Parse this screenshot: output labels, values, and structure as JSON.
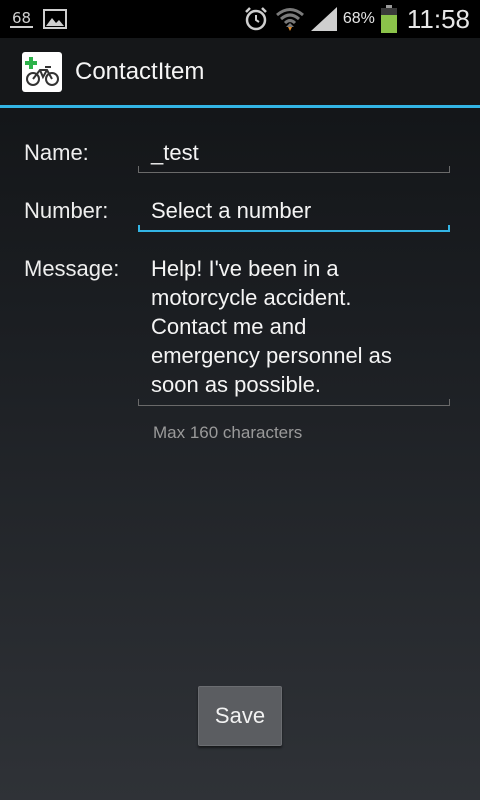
{
  "status_bar": {
    "notification_badge": "68",
    "battery_percent": "68%",
    "clock": "11:58",
    "icons": [
      "notification-68-icon",
      "image-icon",
      "alarm-icon",
      "wifi-icon",
      "signal-icon",
      "battery-icon"
    ],
    "battery_color": "#8bc34a"
  },
  "action_bar": {
    "title": "ContactItem",
    "accent_color": "#33b5e5"
  },
  "form": {
    "name_label": "Name:",
    "name_value": "_test",
    "number_label": "Number:",
    "number_value": "Select a number",
    "message_label": "Message:",
    "message_lines": [
      "Help! I've been in a",
      "motorcycle accident.",
      "Contact me and",
      "emergency personnel as",
      "soon as possible."
    ],
    "message_hint": "Max 160 characters"
  },
  "actions": {
    "save_label": "Save"
  }
}
